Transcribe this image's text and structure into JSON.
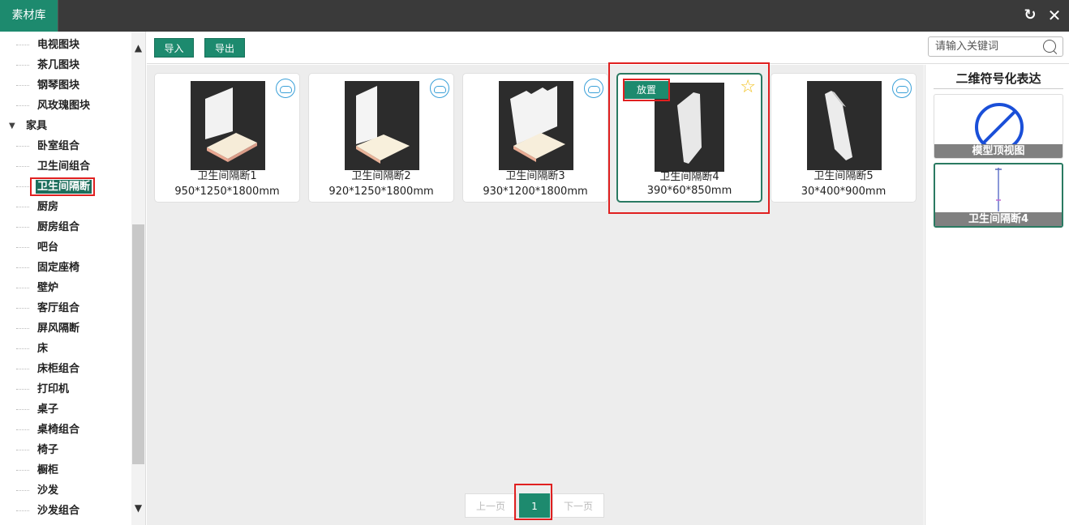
{
  "window": {
    "title": "素材库"
  },
  "sidebar": {
    "items": [
      {
        "label": "电视图块",
        "parent": false,
        "selected": false
      },
      {
        "label": "茶几图块",
        "parent": false,
        "selected": false
      },
      {
        "label": "钢琴图块",
        "parent": false,
        "selected": false
      },
      {
        "label": "风玫瑰图块",
        "parent": false,
        "selected": false
      },
      {
        "label": "家具",
        "parent": true,
        "selected": false
      },
      {
        "label": "卧室组合",
        "parent": false,
        "selected": false
      },
      {
        "label": "卫生间组合",
        "parent": false,
        "selected": false
      },
      {
        "label": "卫生间隔断",
        "parent": false,
        "selected": true
      },
      {
        "label": "厨房",
        "parent": false,
        "selected": false
      },
      {
        "label": "厨房组合",
        "parent": false,
        "selected": false
      },
      {
        "label": "吧台",
        "parent": false,
        "selected": false
      },
      {
        "label": "固定座椅",
        "parent": false,
        "selected": false
      },
      {
        "label": "壁炉",
        "parent": false,
        "selected": false
      },
      {
        "label": "客厅组合",
        "parent": false,
        "selected": false
      },
      {
        "label": "屏风隔断",
        "parent": false,
        "selected": false
      },
      {
        "label": "床",
        "parent": false,
        "selected": false
      },
      {
        "label": "床柜组合",
        "parent": false,
        "selected": false
      },
      {
        "label": "打印机",
        "parent": false,
        "selected": false
      },
      {
        "label": "桌子",
        "parent": false,
        "selected": false
      },
      {
        "label": "桌椅组合",
        "parent": false,
        "selected": false
      },
      {
        "label": "椅子",
        "parent": false,
        "selected": false
      },
      {
        "label": "橱柜",
        "parent": false,
        "selected": false
      },
      {
        "label": "沙发",
        "parent": false,
        "selected": false
      },
      {
        "label": "沙发组合",
        "parent": false,
        "selected": false
      }
    ]
  },
  "toolbar": {
    "import_label": "导入",
    "export_label": "导出",
    "search_placeholder": "请输入关键词"
  },
  "cards": [
    {
      "name": "卫生间隔断1",
      "size": "950*1250*1800mm",
      "active": false
    },
    {
      "name": "卫生间隔断2",
      "size": "920*1250*1800mm",
      "active": false
    },
    {
      "name": "卫生间隔断3",
      "size": "930*1200*1800mm",
      "active": false
    },
    {
      "name": "卫生间隔断4",
      "size": "390*60*850mm",
      "active": true,
      "place_label": "放置"
    },
    {
      "name": "卫生间隔断5",
      "size": "30*400*900mm",
      "active": false
    }
  ],
  "pager": {
    "prev": "上一页",
    "current": "1",
    "next": "下一页"
  },
  "right_panel": {
    "title": "二维符号化表达",
    "symbols": [
      {
        "label": "模型顶视图"
      },
      {
        "label": "卫生间隔断4"
      }
    ]
  },
  "colors": {
    "accent": "#1d8a6e",
    "highlight": "#e02020",
    "cloud": "#3aa0d8",
    "star": "#f2c11d"
  },
  "icons": {
    "refresh": "refresh-icon",
    "close": "close-icon",
    "search": "search-icon",
    "cloud": "cloud-download-icon",
    "star": "star-icon"
  }
}
